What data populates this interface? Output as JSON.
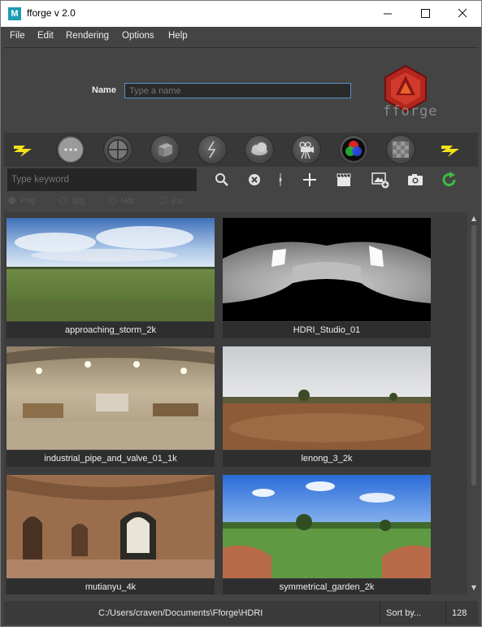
{
  "window": {
    "title": "fforge v 2.0",
    "app_icon": "M",
    "minimize_icon": "minimize-icon",
    "maximize_icon": "maximize-icon",
    "close_icon": "close-icon"
  },
  "menu": [
    "File",
    "Edit",
    "Rendering",
    "Options",
    "Help"
  ],
  "name_field": {
    "label": "Name",
    "value": "",
    "placeholder": "Type a name"
  },
  "logo": {
    "text": "fforge",
    "color": "#c0392b"
  },
  "shader_buttons": [
    "lightning-icon",
    "flat-sphere-icon",
    "crosshair-sphere-icon",
    "cube-icon",
    "lightning-circle-icon",
    "cloud-icon",
    "camera-icon",
    "rgb-icon",
    "checker-icon",
    "lightning-icon"
  ],
  "search": {
    "value": "",
    "placeholder": "Type keyword"
  },
  "tools": [
    "search-icon",
    "clear-icon",
    "divider",
    "add-icon",
    "clapperboard-icon",
    "add-image-icon",
    "snapshot-icon",
    "refresh-icon"
  ],
  "formats": {
    "options": [
      "Png",
      "Jpg",
      "Hdr",
      "Exr"
    ],
    "selected": "Png"
  },
  "items": [
    {
      "label": "approaching_storm_2k"
    },
    {
      "label": "HDRI_Studio_01"
    },
    {
      "label": "industrial_pipe_and_valve_01_1k"
    },
    {
      "label": "lenong_3_2k"
    },
    {
      "label": "mutianyu_4k"
    },
    {
      "label": "symmetrical_garden_2k"
    }
  ],
  "status": {
    "path": "C:/Users/craven/Documents\\Fforge\\HDRI",
    "sort_label": "Sort by...",
    "thumb_size": "128"
  },
  "colors": {
    "accent": "#5a90c8",
    "bolt": "#f2e21a",
    "refresh": "#3dbb45"
  }
}
